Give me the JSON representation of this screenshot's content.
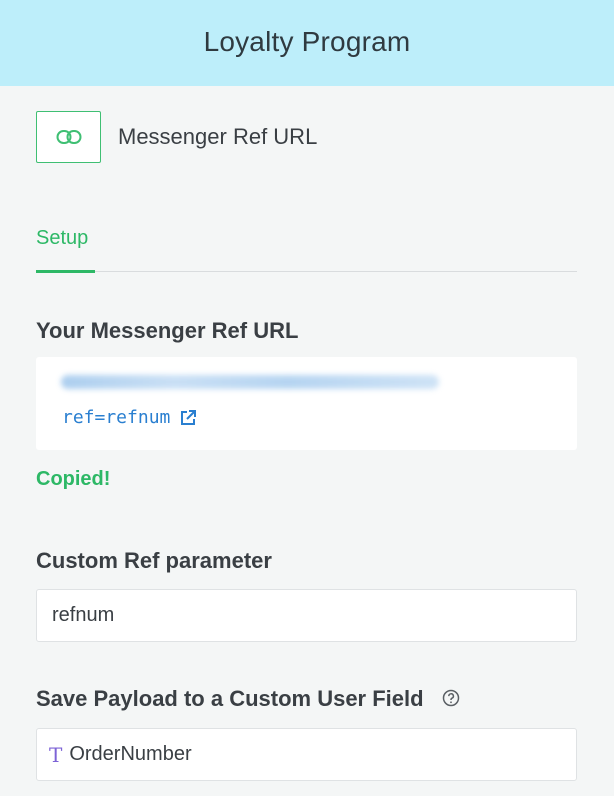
{
  "header": {
    "title": "Loyalty Program"
  },
  "trigger": {
    "icon": "link-icon",
    "label": "Messenger Ref URL"
  },
  "tabs": [
    {
      "label": "Setup",
      "active": true
    }
  ],
  "ref_url": {
    "label": "Your Messenger Ref URL",
    "query": "ref=refnum",
    "link_icon": "external-link-icon",
    "status": "Copied!"
  },
  "custom_ref": {
    "label": "Custom Ref parameter",
    "value": "refnum"
  },
  "payload": {
    "label": "Save Payload to a Custom User Field",
    "help_icon": "question-circle-icon",
    "field_type_icon": "text-type-icon",
    "value": "OrderNumber"
  },
  "colors": {
    "header_bg": "#bdeefa",
    "accent_green": "#2db866",
    "link_blue": "#2a7fd0",
    "field_purple": "#7d63d6"
  }
}
